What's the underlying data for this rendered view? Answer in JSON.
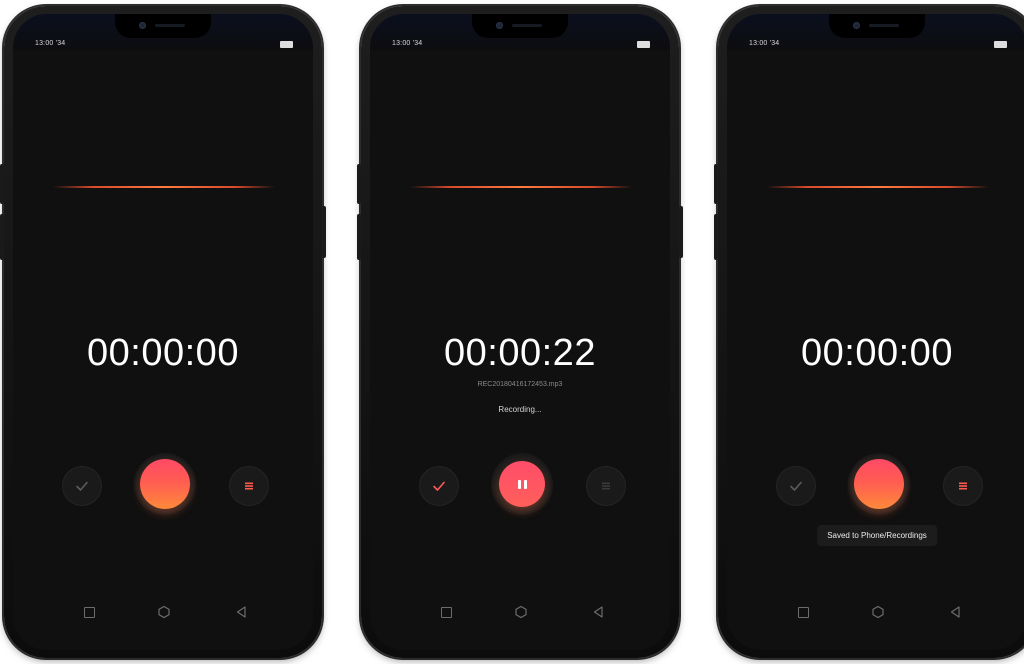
{
  "screens": [
    {
      "state": "idle",
      "status_time": "13:00 '34",
      "timer": "00:00:00"
    },
    {
      "state": "recording",
      "status_time": "13:00 '34",
      "timer": "00:00:22",
      "filename": "REC20180416172453.mp3",
      "status_text": "Recording..."
    },
    {
      "state": "saved",
      "status_time": "13:00 '34",
      "timer": "00:00:00",
      "toast": "Saved to Phone/Recordings"
    }
  ],
  "icons": {
    "confirm": "check-icon",
    "record": "record-icon",
    "pause": "pause-icon",
    "list": "list-icon",
    "nav_recent": "square-icon",
    "nav_home": "hexagon-icon",
    "nav_back": "triangle-back-icon"
  },
  "colors": {
    "accent_top": "#ff4a66",
    "accent_bottom": "#ff8a3a",
    "waveform": "#ff7a40",
    "check_active": "#ff5a5a",
    "list_active": "#ff5a50",
    "icon_inactive": "#5c5c5c"
  }
}
